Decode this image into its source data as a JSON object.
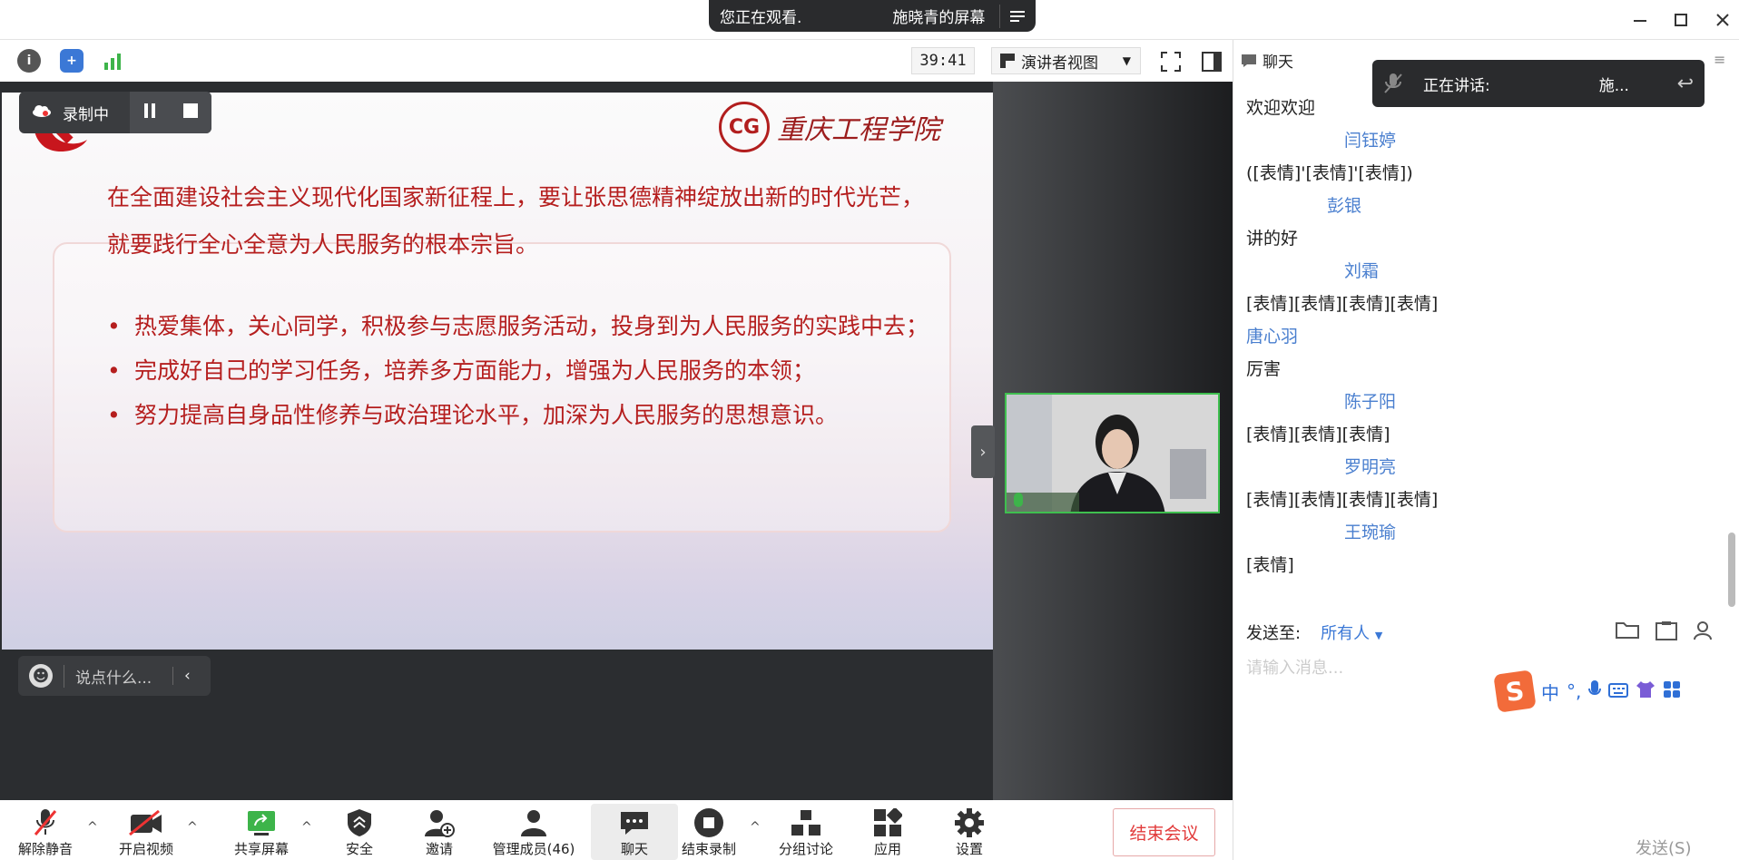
{
  "window": {
    "viewing_banner": [
      "您正在观看.",
      "施晓青的屏幕"
    ],
    "controls": [
      "minimize",
      "maximize",
      "close"
    ]
  },
  "toolbar": {
    "timer": "39:41",
    "view_mode": "演讲者视图",
    "icons": [
      "info-icon",
      "shield-icon",
      "signal-icon",
      "fullscreen-icon",
      "sidebar-icon"
    ]
  },
  "recording": {
    "label": "录制中"
  },
  "slide": {
    "school_name": "重庆工程学院",
    "seal_text": "CG",
    "intro": "在全面建设社会主义现代化国家新征程上，要让张思德精神绽放出新的时代光芒，就要践行全心全意为人民服务的根本宗旨。",
    "bullets": [
      "热爱集体，关心同学，积极参与志愿服务活动，投身到为人民服务的实践中去；",
      "完成好自己的学习任务，培养多方面能力，增强为人民服务的本领；",
      "努力提高自身品性修养与政治理论水平，加深为人民服务的思想意识。"
    ]
  },
  "say_box": {
    "placeholder": "说点什么..."
  },
  "bottom_bar": {
    "buttons": [
      {
        "label": "解除静音",
        "icon": "mic-off-icon"
      },
      {
        "label": "开启视频",
        "icon": "camera-off-icon"
      },
      {
        "label": "共享屏幕",
        "icon": "share-screen-icon"
      },
      {
        "label": "安全",
        "icon": "security-icon"
      },
      {
        "label": "邀请",
        "icon": "invite-icon"
      },
      {
        "label": "管理成员(46)",
        "icon": "members-icon"
      },
      {
        "label": "聊天",
        "icon": "chat-icon"
      },
      {
        "label": "结束录制",
        "icon": "stop-record-icon"
      },
      {
        "label": "分组讨论",
        "icon": "breakout-icon"
      },
      {
        "label": "应用",
        "icon": "apps-icon"
      },
      {
        "label": "设置",
        "icon": "settings-icon"
      }
    ],
    "end_meeting": "结束会议"
  },
  "chat": {
    "title": "聊天",
    "speaking_label": "正在讲话:",
    "speaking_name": "施...",
    "messages": [
      {
        "type": "text",
        "text": "欢迎欢迎"
      },
      {
        "type": "sender",
        "text": "闫钰婷"
      },
      {
        "type": "text",
        "text": "([表情]'[表情]'[表情])"
      },
      {
        "type": "sender",
        "text": "彭银"
      },
      {
        "type": "text",
        "text": "讲的好"
      },
      {
        "type": "sender",
        "text": "刘霜"
      },
      {
        "type": "text",
        "text": "[表情][表情][表情][表情]"
      },
      {
        "type": "sender",
        "text": "唐心羽"
      },
      {
        "type": "text",
        "text": "厉害"
      },
      {
        "type": "sender",
        "text": "陈子阳"
      },
      {
        "type": "text",
        "text": "[表情][表情][表情]"
      },
      {
        "type": "sender",
        "text": "罗明亮"
      },
      {
        "type": "text",
        "text": "[表情][表情][表情][表情]"
      },
      {
        "type": "sender",
        "text": "王琬瑜"
      },
      {
        "type": "text",
        "text": "[表情]"
      }
    ],
    "send_to_label": "发送至:",
    "send_to_value": "所有人",
    "input_placeholder": "请输入消息...",
    "send_button": "发送(S)",
    "ime_label": "中"
  }
}
